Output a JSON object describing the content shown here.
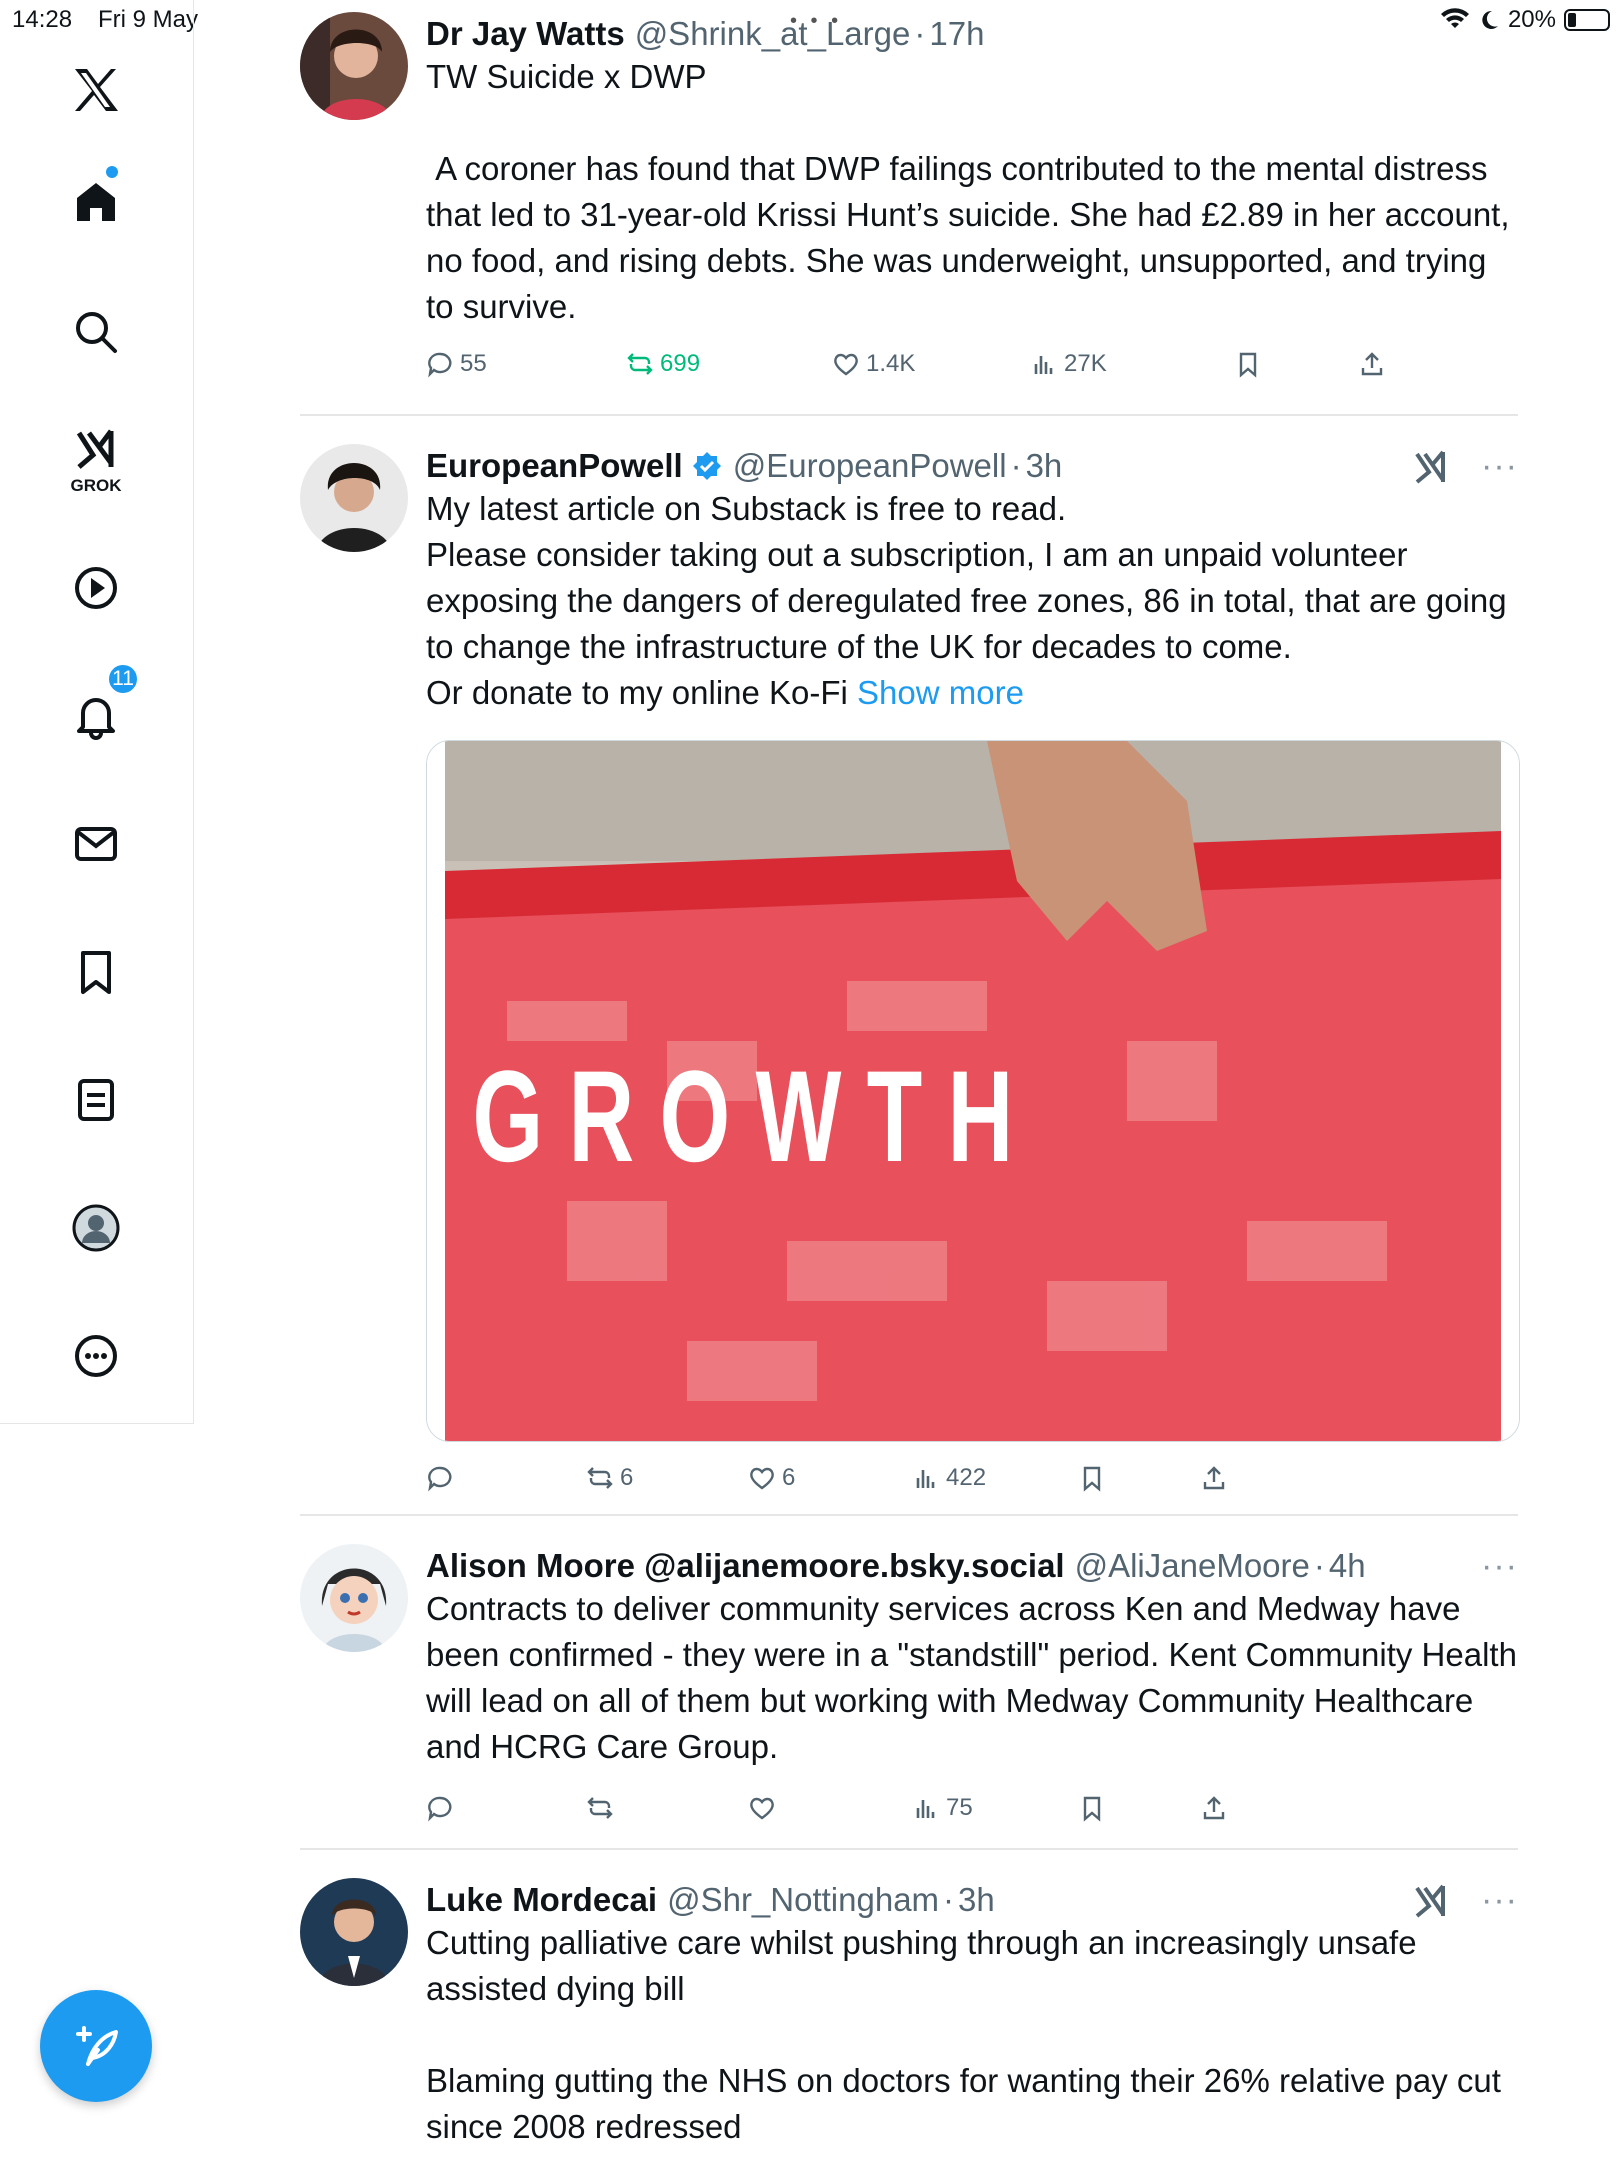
{
  "status_bar": {
    "time": "14:28",
    "date": "Fri 9 May",
    "battery": "20%"
  },
  "sidebar": {
    "grok_label": "GROK",
    "notifications_count": "11"
  },
  "tweets": [
    {
      "name": "Dr Jay Watts",
      "handle": "@Shrink_at_Large",
      "time": "17h",
      "text": "TW Suicide x DWP\n\n A coroner has found that DWP failings contributed to the mental distress that led to 31-year-old Krissi Hunt’s suicide. She had £2.89 in her account, no food, and rising debts. She was underweight, unsupported, and trying to survive.",
      "replies": "55",
      "reposts": "699",
      "likes": "1.4K",
      "views": "27K"
    },
    {
      "name": "EuropeanPowell",
      "handle": "@EuropeanPowell",
      "time": "3h",
      "text": "My latest article on Substack is free to read.\nPlease consider taking out a subscription, I am an unpaid volunteer exposing the dangers of deregulated free zones, 86 in total, that are going to change the infrastructure of the UK for decades to come.\nOr donate to my online Ko-Fi ",
      "show_more": "Show more",
      "image_text": "G G G R O W T H",
      "replies": "",
      "reposts": "6",
      "likes": "6",
      "views": "422"
    },
    {
      "name": "Alison Moore @alijanemoore.bsky.social",
      "handle": "@AliJaneMoore",
      "time": "4h",
      "text": "Contracts to deliver community services across Ken and Medway have been confirmed - they were in a \"standstill\" period. Kent Community Health will lead on all of them but working with Medway Community Healthcare and HCRG Care Group.",
      "replies": "",
      "reposts": "",
      "likes": "",
      "views": "75"
    },
    {
      "name": "Luke Mordecai",
      "handle": "@Shr_Nottingham",
      "time": "3h",
      "text": "Cutting palliative care whilst pushing through an increasingly unsafe assisted dying bill\n\nBlaming gutting the NHS on doctors for wanting their 26% relative pay cut since 2008 redressed"
    }
  ],
  "colors": {
    "accent": "#1d9bf0",
    "repost_green": "#00ba7c",
    "muted": "#536471",
    "image_red": "#e8505b"
  }
}
